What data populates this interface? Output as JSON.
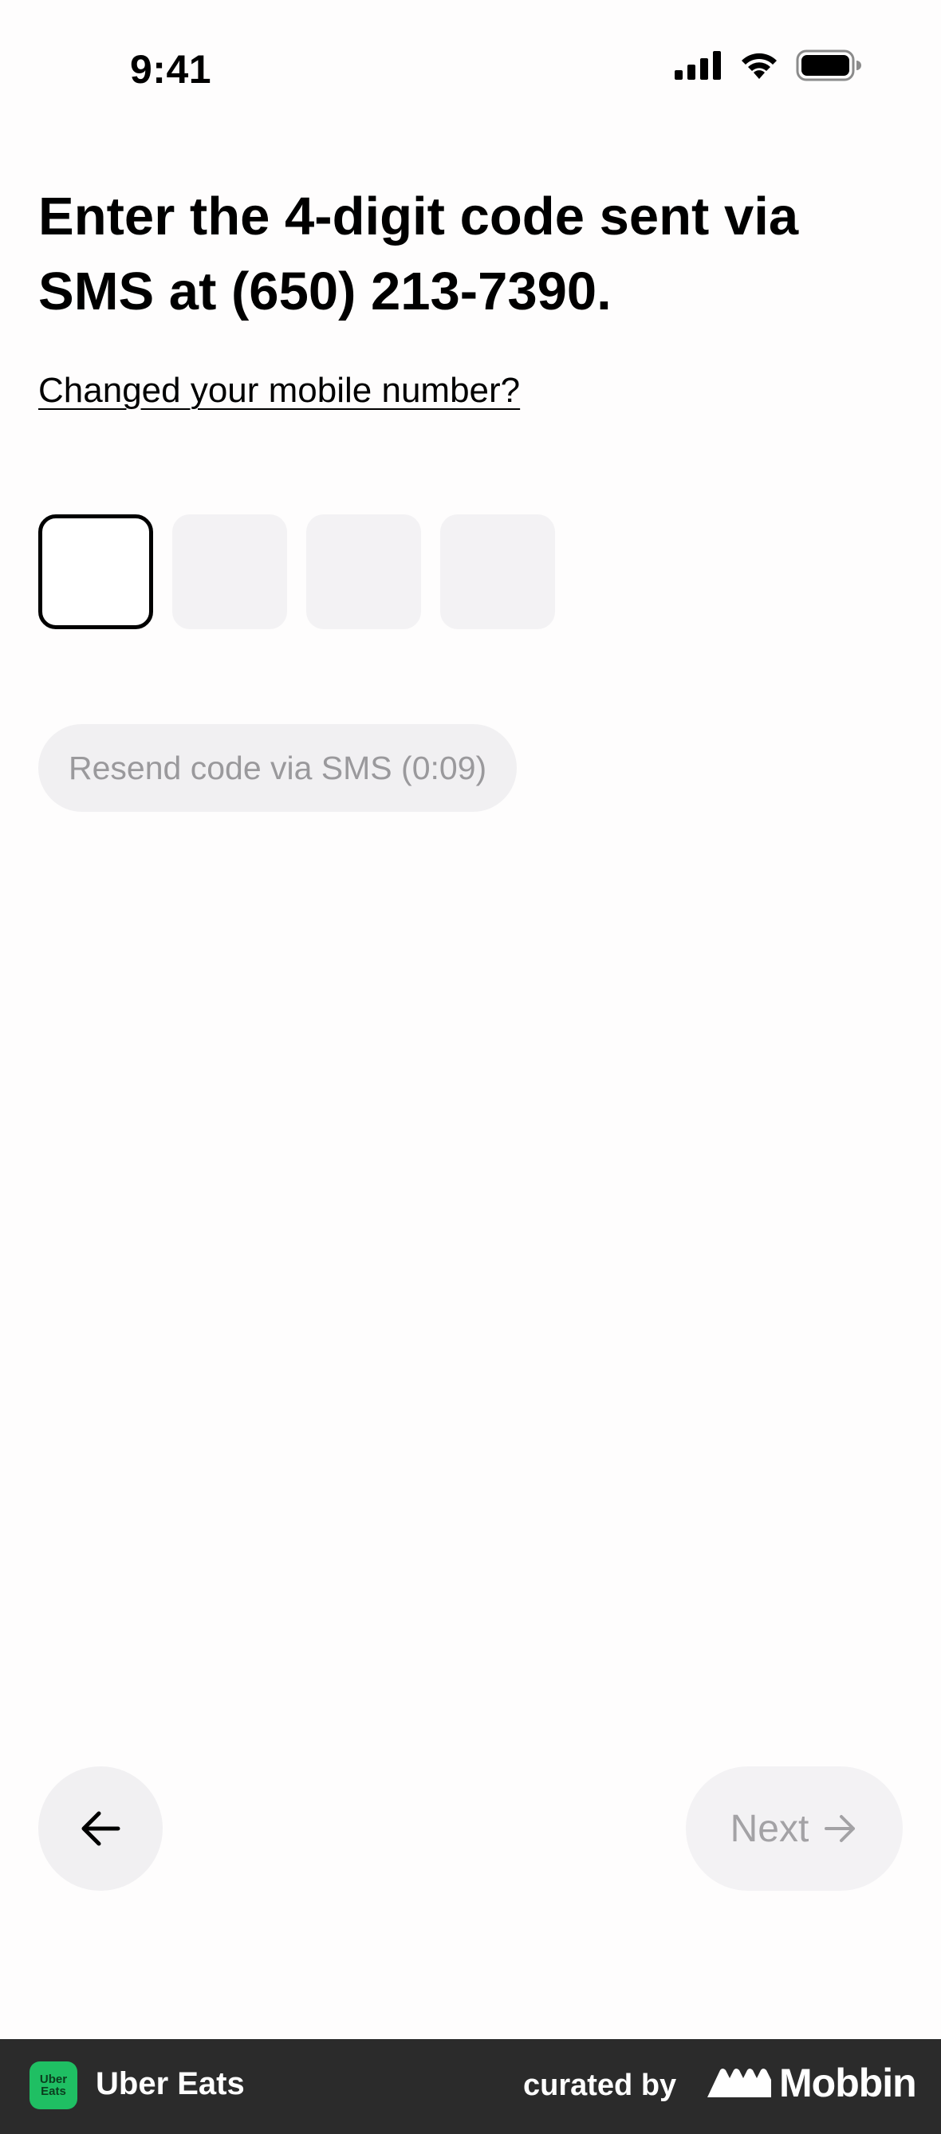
{
  "status_bar": {
    "time": "9:41"
  },
  "verification": {
    "title": "Enter the 4-digit code sent via SMS at (650) 213-7390.",
    "change_number_link": "Changed your mobile number?",
    "code_digits": [
      "",
      "",
      "",
      ""
    ],
    "resend_label": "Resend code via SMS (0:09)"
  },
  "navigation": {
    "next_label": "Next"
  },
  "footer": {
    "app_logo_line1": "Uber",
    "app_logo_line2": "Eats",
    "app_name": "Uber Eats",
    "curated_by": "curated by",
    "brand": "Mobbin"
  },
  "colors": {
    "accent_logo": "#1fbf63",
    "footer_bg": "#2b2b2b",
    "disabled_bg": "#f3f2f4",
    "disabled_text": "#a3a2a5"
  },
  "icons": {
    "signal": "cellular-signal-icon",
    "wifi": "wifi-icon",
    "battery": "battery-icon",
    "back": "arrow-left-icon",
    "next": "arrow-right-icon"
  }
}
